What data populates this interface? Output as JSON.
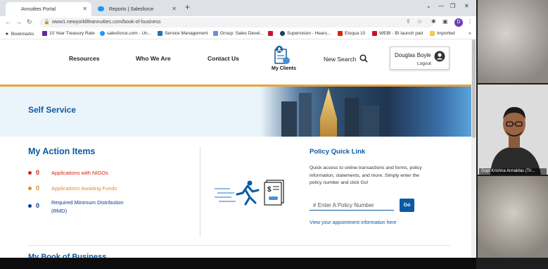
{
  "browser": {
    "tabs": [
      {
        "label": "Annuities Portal",
        "active": true
      },
      {
        "label": "Reports | Salesforce",
        "active": false
      }
    ],
    "new_tab_icon": "plus-icon",
    "url": "www1.newyorklifeannuities.com/book-of-business",
    "profile_initial": "D",
    "bookmarks": [
      {
        "label": "Bookmarks",
        "icon": "star-icon"
      },
      {
        "label": "10 Year Treasury Rate",
        "icon": "y-icon"
      },
      {
        "label": "salesforce.com - Un...",
        "icon": "salesforce-icon"
      },
      {
        "label": "Service Management",
        "icon": "sn-icon"
      },
      {
        "label": "Group: Sales Devel...",
        "icon": "group-icon"
      },
      {
        "label": "P",
        "icon": "p-icon"
      },
      {
        "label": "Supervision - Hears...",
        "icon": "h-icon"
      },
      {
        "label": "Eloqua 10",
        "icon": "eloqua-icon"
      },
      {
        "label": "WEBI - BI launch pad",
        "icon": "webi-icon"
      },
      {
        "label": "Imported",
        "icon": "folder-icon"
      }
    ],
    "more_bookmarks": "»"
  },
  "site": {
    "nav": [
      {
        "label": "Resources"
      },
      {
        "label": "Who We Are"
      },
      {
        "label": "Contact Us"
      }
    ],
    "my_clients": "My Clients",
    "new_search": "New Search",
    "user_name": "Douglas Boyle",
    "logout": "Logout"
  },
  "banner": {
    "title": "Self Service"
  },
  "action_items": {
    "title": "My Action Items",
    "items": [
      {
        "count": "0",
        "label": "Applications with NIGOs",
        "color": "#d9230f"
      },
      {
        "count": "0",
        "label": "Applications Awaiting Funds",
        "color": "#e88a2a"
      },
      {
        "count": "0",
        "label": "Required Minimum Distribution (RMD)",
        "color": "#0b3c8c"
      }
    ]
  },
  "policy_quick_link": {
    "title": "Policy Quick Link",
    "description": "Quick access to online transactions and forms, policy information, statements, and more. Simply enter the policy number and click Go!",
    "placeholder": "Enter A Policy Number",
    "hash": "#",
    "go_label": "Go",
    "link_text": "View your appointment information here"
  },
  "next_section_title": "My Book of Business",
  "video": {
    "participant_name": "Gopi Krishna Annaldas (Tri..."
  },
  "colors": {
    "brand_blue": "#0b5aa3",
    "accent_orange": "#e7a43b",
    "alert_red": "#d9230f"
  }
}
